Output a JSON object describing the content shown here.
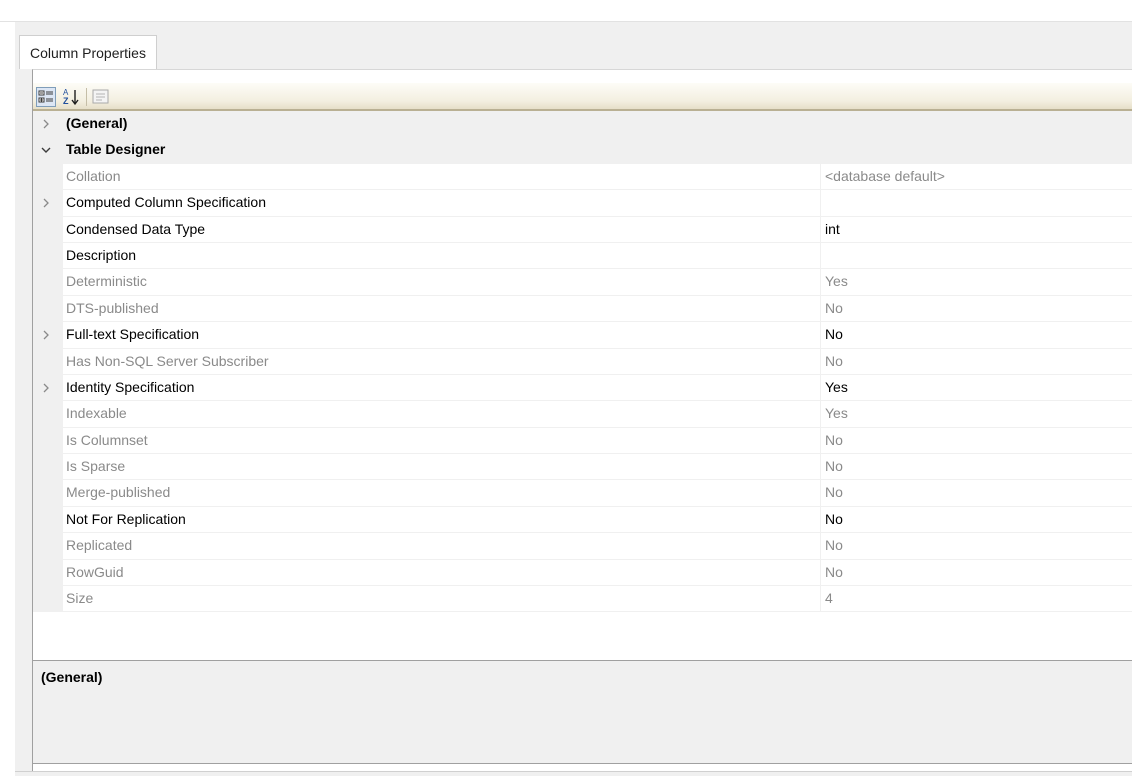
{
  "tab": {
    "label": "Column Properties"
  },
  "toolbar": {
    "categorized_icon": "categorized-icon",
    "alphabetical_icon": "sort-az-icon",
    "property_pages_icon": "property-pages-icon"
  },
  "grid": {
    "general": {
      "label": "(General)",
      "expanded": false
    },
    "table_designer": {
      "label": "Table Designer",
      "expanded": true
    },
    "rows": [
      {
        "name": "Collation",
        "value": "<database default>",
        "expandable": false
      },
      {
        "name": "Computed Column Specification",
        "value": "",
        "expandable": true
      },
      {
        "name": "Condensed Data Type",
        "value": "int",
        "expandable": false
      },
      {
        "name": "Description",
        "value": "",
        "expandable": false
      },
      {
        "name": "Deterministic",
        "value": "Yes",
        "expandable": false
      },
      {
        "name": "DTS-published",
        "value": "No",
        "expandable": false
      },
      {
        "name": "Full-text Specification",
        "value": "No",
        "expandable": true
      },
      {
        "name": "Has Non-SQL Server Subscriber",
        "value": "No",
        "expandable": false
      },
      {
        "name": "Identity Specification",
        "value": "Yes",
        "expandable": true
      },
      {
        "name": "Indexable",
        "value": "Yes",
        "expandable": false
      },
      {
        "name": "Is Columnset",
        "value": "No",
        "expandable": false
      },
      {
        "name": "Is Sparse",
        "value": "No",
        "expandable": false
      },
      {
        "name": "Merge-published",
        "value": "No",
        "expandable": false
      },
      {
        "name": "Not For Replication",
        "value": "No",
        "expandable": false
      },
      {
        "name": "Replicated",
        "value": "No",
        "expandable": false
      },
      {
        "name": "RowGuid",
        "value": "No",
        "expandable": false
      },
      {
        "name": "Size",
        "value": "4",
        "expandable": false
      }
    ]
  },
  "help": {
    "title": "(General)"
  },
  "colors": {
    "readonly_text": "#8a8a8a",
    "editable_text": "#000000",
    "gutter": "#f0f0f0",
    "toolbar_border": "#b9b093"
  }
}
